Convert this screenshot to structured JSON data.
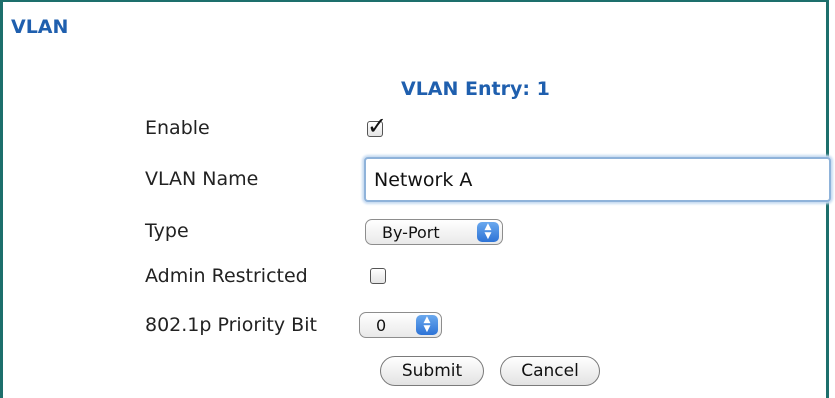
{
  "section": {
    "title": "VLAN"
  },
  "entry": {
    "title": "VLAN Entry: 1"
  },
  "form": {
    "enable": {
      "label": "Enable",
      "checked": true
    },
    "vlan_name": {
      "label": "VLAN Name",
      "value": "Network A"
    },
    "type": {
      "label": "Type",
      "value": "By-Port"
    },
    "admin_restricted": {
      "label": "Admin Restricted",
      "checked": false
    },
    "priority_bit": {
      "label": "802.1p Priority Bit",
      "value": "0"
    }
  },
  "buttons": {
    "submit": "Submit",
    "cancel": "Cancel"
  },
  "icons": {
    "check": "checkmark-icon",
    "stepper": "up-down-arrows-icon"
  },
  "colors": {
    "heading": "#1f5fae",
    "frame": "#1d6f6c",
    "stepper": "#2d73d6"
  }
}
